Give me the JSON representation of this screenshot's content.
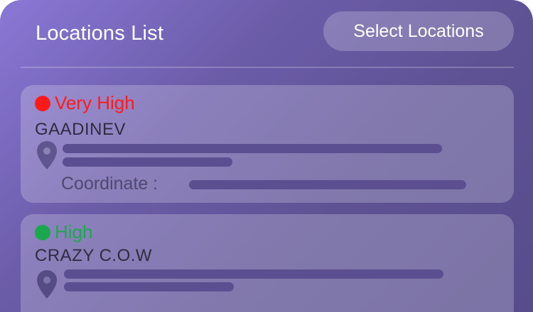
{
  "header": {
    "title": "Locations List",
    "select_button": "Select Locations"
  },
  "locations": [
    {
      "priority": "Very High",
      "priority_color": "#ff1a1a",
      "name": "GAADINEV",
      "coordinate_label": "Coordinate :"
    },
    {
      "priority": "High",
      "priority_color": "#1aa84e",
      "name": "CRAZY C.O.W"
    }
  ],
  "icons": {
    "location": "map-pin-icon"
  }
}
